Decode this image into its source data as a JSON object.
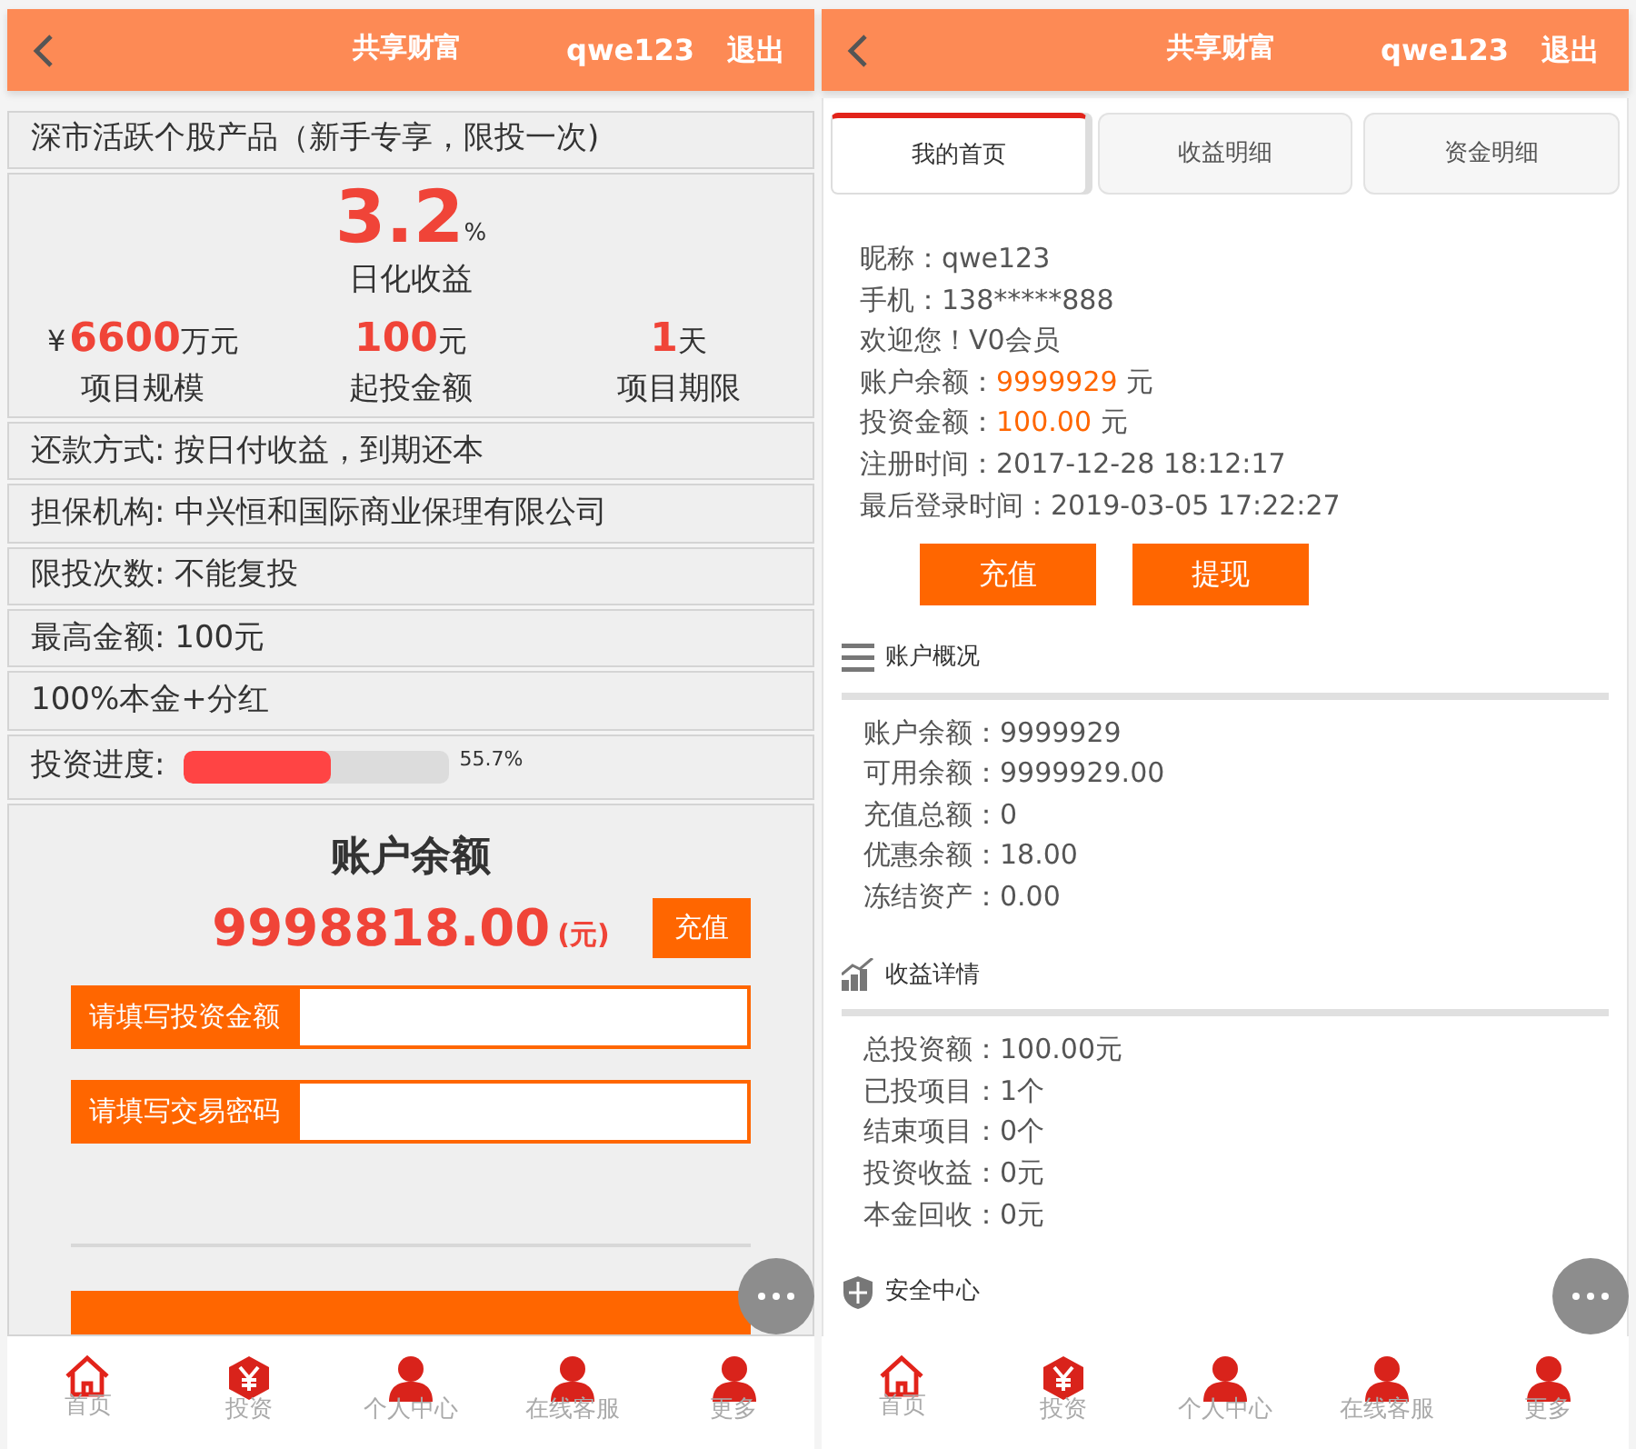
{
  "product_screen": {
    "header": {
      "title": "共享财富",
      "user": "qwe123",
      "logout": "退出"
    },
    "product_title": "深市活跃个股产品（新手专享，限投一次)",
    "rate": {
      "value": "3.2",
      "unit": "%",
      "label": "日化收益"
    },
    "stats": [
      {
        "prefix": "¥",
        "value": "6600",
        "unit": "万元",
        "label": "项目规模"
      },
      {
        "value": "100",
        "unit": "元",
        "label": "起投金额"
      },
      {
        "value": "1",
        "unit": "天",
        "label": "项目期限"
      }
    ],
    "details": [
      "还款方式: 按日付收益，到期还本",
      "担保机构: 中兴恒和国际商业保理有限公司",
      "限投次数: 不能复投",
      "最高金额: 100元",
      "100%本金+分红"
    ],
    "progress": {
      "label": "投资进度:",
      "level": 0.557,
      "reading": "55.7%"
    },
    "account": {
      "title": "账户余额",
      "balance": "9998818.00",
      "unit": "(元)",
      "recharge_button": "充值",
      "fields": [
        {
          "label": "请填写投资金额"
        },
        {
          "label": "请填写交易密码"
        }
      ]
    },
    "nav": [
      {
        "kind": "home",
        "label": "首页"
      },
      {
        "kind": "yen",
        "label": "投资"
      },
      {
        "kind": "person",
        "label": "个人中心"
      },
      {
        "kind": "person",
        "label": "在线客服"
      },
      {
        "kind": "person",
        "label": "更多"
      }
    ]
  },
  "account_screen": {
    "header": {
      "title": "共享财富",
      "user": "qwe123",
      "logout": "退出"
    },
    "tabs": [
      {
        "label": "我的首页",
        "selected": true
      },
      {
        "label": "收益明细",
        "selected": false
      },
      {
        "label": "资金明细",
        "selected": false
      }
    ],
    "profile": [
      {
        "label": "昵称：",
        "value": "qwe123",
        "highlighted": false
      },
      {
        "label": "手机：",
        "value": "138*****888",
        "highlighted": false
      },
      {
        "label": "欢迎您！",
        "value": "V0会员",
        "highlighted": false
      },
      {
        "label": "账户余额：",
        "value": "9999929",
        "unit": " 元",
        "highlighted": true
      },
      {
        "label": "投资金额：",
        "value": "100.00",
        "unit": " 元",
        "highlighted": true
      },
      {
        "label": "注册时间：",
        "value": "2017-12-28 18:12:17",
        "highlighted": false
      },
      {
        "label": "最后登录时间：",
        "value": "2019-03-05 17:22:27",
        "highlighted": false
      }
    ],
    "buttons": [
      "充值",
      "提现"
    ],
    "sections": [
      {
        "kind": "list",
        "title": "账户概况",
        "lines": [
          "账户余额：9999929",
          "可用余额：9999929.00",
          "充值总额：0",
          "优惠余额：18.00",
          "冻结资产：0.00"
        ]
      },
      {
        "kind": "chart",
        "title": "收益详情",
        "lines": [
          "总投资额：100.00元",
          "已投项目：1个",
          "结束项目：0个",
          "投资收益：0元",
          "本金回收：0元"
        ]
      },
      {
        "kind": "shield",
        "title": "安全中心"
      }
    ],
    "nav": [
      {
        "kind": "home",
        "label": "首页"
      },
      {
        "kind": "yen",
        "label": "投资"
      },
      {
        "kind": "person",
        "label": "个人中心"
      },
      {
        "kind": "person",
        "label": "在线客服"
      },
      {
        "kind": "person",
        "label": "更多"
      }
    ]
  }
}
